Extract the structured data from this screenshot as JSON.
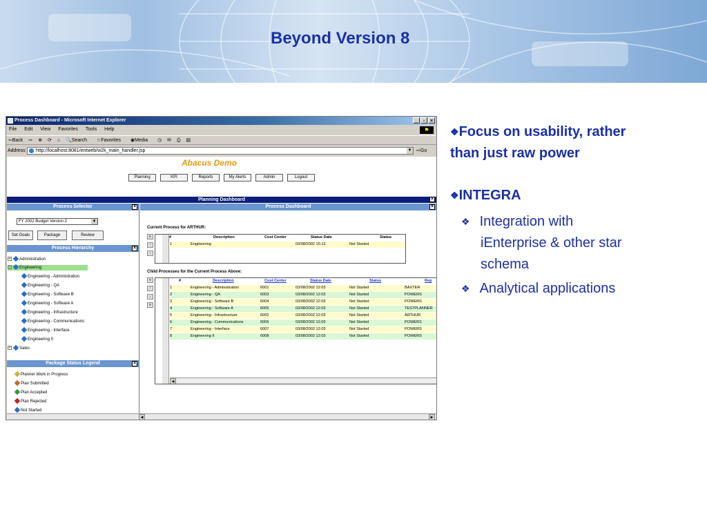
{
  "slide": {
    "title": "Beyond Version 8",
    "bullets": [
      {
        "symbol": "❖",
        "line1": "Focus on usability, rather",
        "line2": "than just raw power"
      },
      {
        "symbol": "❖",
        "text": "INTEGRA"
      }
    ],
    "sub_bullets": [
      {
        "symbol": "❖",
        "line1": "Integration with",
        "line2": "iEnterprise & other star",
        "line3": "schema"
      },
      {
        "symbol": "❖",
        "line1": "Analytical applications"
      }
    ],
    "colors": {
      "title": "#1b2fa8",
      "app_title": "#e39a0c",
      "panel_header": "#6a95cf",
      "dashboard_bar": "#0a1e7a"
    }
  },
  "browser": {
    "title": "Process Dashboard - Microsoft Internet Explorer",
    "menu": [
      "File",
      "Edit",
      "View",
      "Favorites",
      "Tools",
      "Help"
    ],
    "toolbar": {
      "back": "⇦Back",
      "forward": "⇨",
      "search": "Search",
      "favorites": "Favorites",
      "media": "Media"
    },
    "address_label": "Address",
    "address_value": "http://localhost:8081/entweb/w2k_main_handler.jsp",
    "go": "Go"
  },
  "app": {
    "title": "Abacus Demo",
    "nav": [
      "Planning",
      "KPI",
      "Reports",
      "My Alerts",
      "Admin",
      "Logout"
    ],
    "dashboard_bar": "Planning Dashboard",
    "process_selector": "Process Selector",
    "budget_selected": "FY 2002 Budget Version 2",
    "buttons": {
      "set_goals": "Set Goals",
      "package": "Package",
      "review": "Review"
    },
    "process_hierarchy": "Process Hierarchy",
    "tree": {
      "administration": "Administration",
      "engineering": "Engineering",
      "children": [
        "Engineering - Administration",
        "Engineering - QA",
        "Engineering - Software B",
        "Engineering - Software A",
        "Engineering - Infrastructure",
        "Engineering - Communications",
        "Engineering - Interface",
        "Engineering II"
      ],
      "sales": "Sales"
    },
    "legend_title": "Package Status Legend",
    "legend": [
      {
        "label": "Planner Work in Progress",
        "color": "#c9b23a"
      },
      {
        "label": "Plan Submitted",
        "color": "#b86b2a"
      },
      {
        "label": "Plan Accepted",
        "color": "#2e9a3a"
      },
      {
        "label": "Plan Rejected",
        "color": "#c02020"
      },
      {
        "label": "Not Started",
        "color": "#2a6cc4"
      }
    ],
    "dashboard_title": "Process Dashboard",
    "current_label": "Current Process for ARTHUR:",
    "current_headers": [
      "#",
      "Description",
      "Cost Center",
      "Status Date",
      "Status"
    ],
    "current_row": [
      "1",
      "Engineering",
      "",
      "03/08/2002 15:13",
      "Not Started"
    ],
    "child_label": "Child Processes for the Current Process Above:",
    "child_headers": [
      "#",
      "Description",
      "Cost Center",
      "Status Date",
      "Status",
      "Rep"
    ],
    "child_rows": [
      [
        "1",
        "Engineering - Administration",
        "6001",
        "03/08/2002 12:03",
        "Not Started",
        "BAXTER"
      ],
      [
        "2",
        "Engineering - QA",
        "6003",
        "03/08/2002 12:03",
        "Not Started",
        "POWERS"
      ],
      [
        "3",
        "Engineering - Software B",
        "6004",
        "03/08/2002 12:03",
        "Not Started",
        "POWERS"
      ],
      [
        "4",
        "Engineering - Software A",
        "6005",
        "03/08/2002 12:03",
        "Not Started",
        "TESTPLANNER"
      ],
      [
        "5",
        "Engineering - Infrastructure",
        "6002",
        "03/08/2002 12:03",
        "Not Started",
        "ARTHUR"
      ],
      [
        "6",
        "Engineering - Communications",
        "6006",
        "03/08/2002 12:03",
        "Not Started",
        "POWERS"
      ],
      [
        "7",
        "Engineering - Interface",
        "6007",
        "03/08/2002 12:03",
        "Not Started",
        "POWERS"
      ],
      [
        "8",
        "Engineering II",
        "6008",
        "03/08/2002 12:03",
        "Not Started",
        "POWERS"
      ]
    ]
  }
}
